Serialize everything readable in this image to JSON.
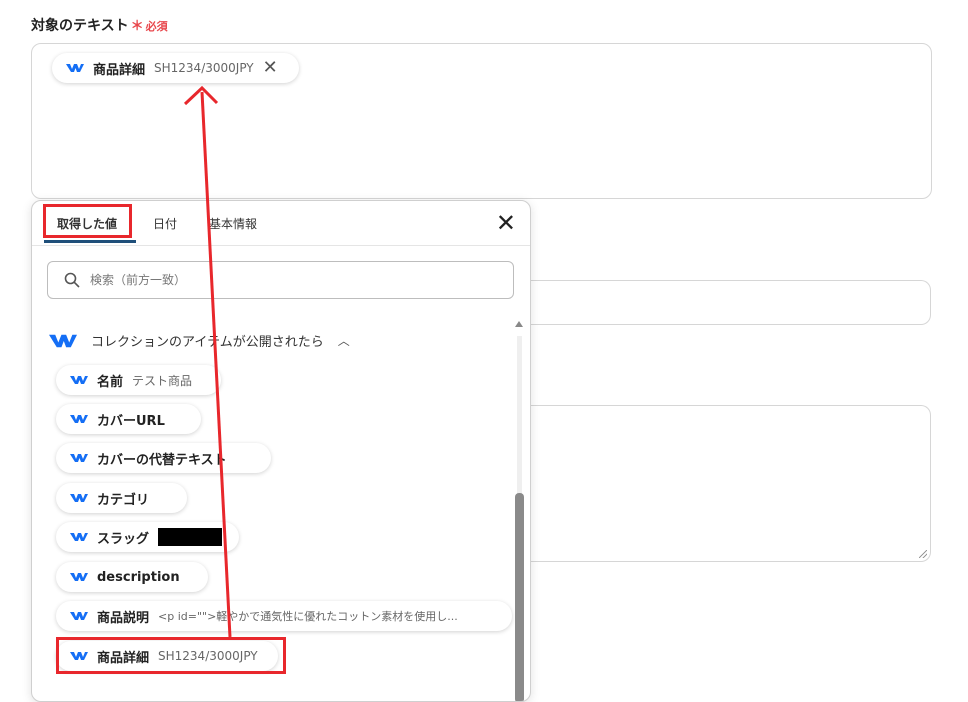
{
  "field": {
    "label": "対象のテキスト",
    "required_mark": "＊",
    "required_text": "必須"
  },
  "selected_chip": {
    "label": "商品詳細",
    "value": "SH1234/3000JPY"
  },
  "panel": {
    "tabs": [
      "取得した値",
      "日付",
      "基本情報"
    ],
    "active_tab": "取得した値",
    "search_placeholder": "検索（前方一致）",
    "group_title": "コレクションのアイテムが公開されたら",
    "items": [
      {
        "label": "名前",
        "value": "テスト商品"
      },
      {
        "label": "カバーURL",
        "value": ""
      },
      {
        "label": "カバーの代替テキスト",
        "value": ""
      },
      {
        "label": "カテゴリ",
        "value": ""
      },
      {
        "label": "スラッグ",
        "value": ""
      },
      {
        "label": "description",
        "value": ""
      },
      {
        "label": "商品説明",
        "value": "<p id=\"\">軽やかで通気性に優れたコットン素材を使用し..."
      },
      {
        "label": "商品詳細",
        "value": "SH1234/3000JPY"
      }
    ]
  },
  "colors": {
    "accent": "#1f4f7a",
    "webflow_blue": "#146ef5",
    "highlight_red": "#e8272c",
    "required_red": "#e8464b"
  },
  "icons": [
    "webflow-icon",
    "close-icon",
    "search-icon",
    "chevron-up-icon",
    "arrow-annotation"
  ]
}
